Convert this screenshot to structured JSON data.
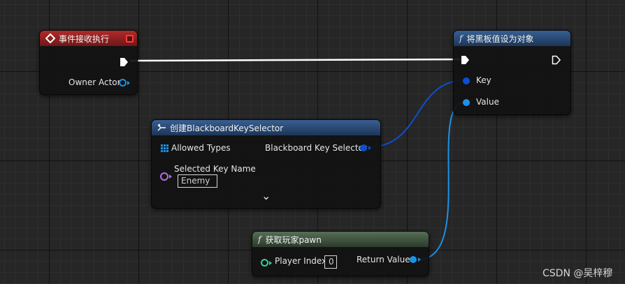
{
  "event_node": {
    "title": "事件接收执行",
    "owner_actor_label": "Owner Actor",
    "header_color": "#a52525"
  },
  "set_node": {
    "function_glyph": "f",
    "title": "将黑板值设为对象",
    "key_label": "Key",
    "value_label": "Value",
    "header_color": "#2f5688"
  },
  "make_node": {
    "title": "创建BlackboardKeySelector",
    "allowed_types_label": "Allowed Types",
    "selector_output_label": "Blackboard Key Selector",
    "selected_key_label": "Selected Key Name",
    "selected_key_value": "Enemy",
    "expand_glyph": "⌄",
    "header_color": "#2f5688"
  },
  "pawn_node": {
    "function_glyph": "f",
    "title": "获取玩家pawn",
    "player_index_label": "Player Index",
    "player_index_value": "0",
    "return_value_label": "Return Value",
    "header_color": "#4f654f"
  },
  "colors": {
    "exec_wire": "#ffffff",
    "key_wire": "#0d4fd0",
    "object_wire": "#1a93e6",
    "canvas": "#262626"
  },
  "watermark": "CSDN @吴梓穆"
}
